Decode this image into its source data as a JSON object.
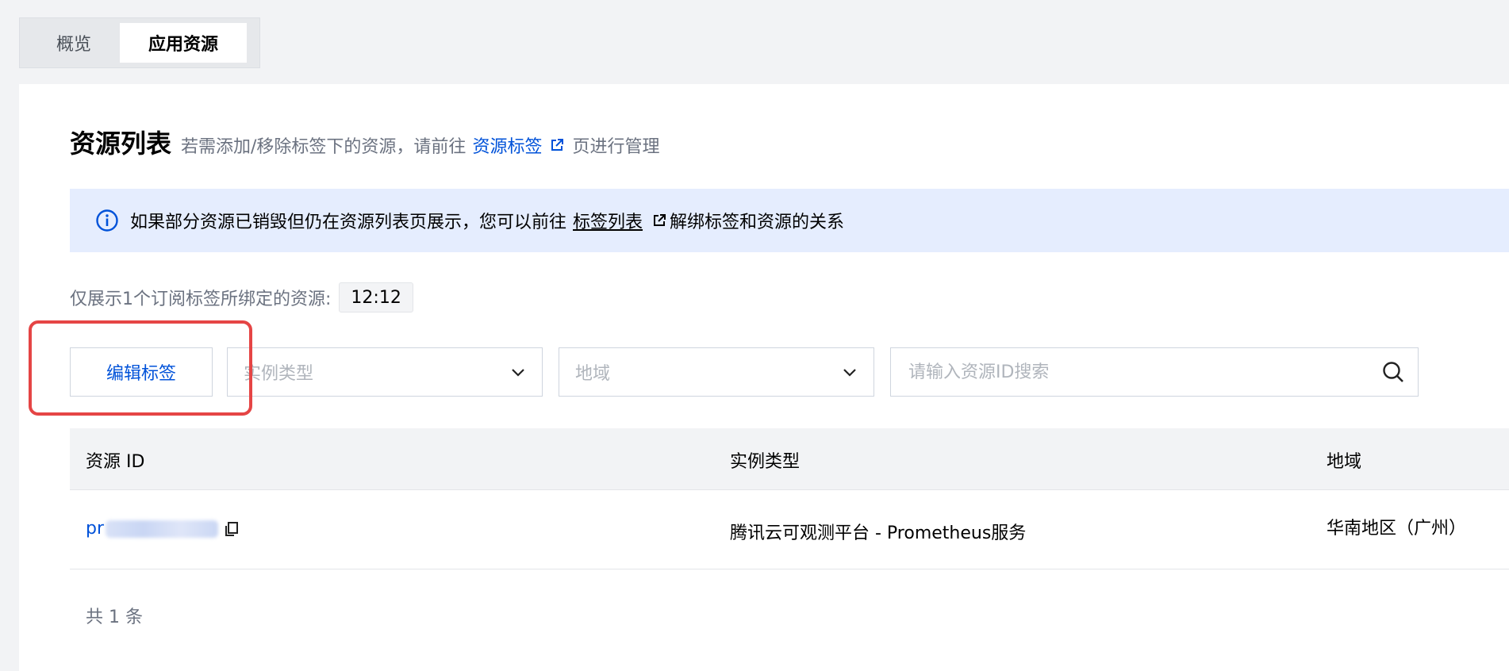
{
  "tabs": [
    {
      "label": "概览",
      "active": false
    },
    {
      "label": "应用资源",
      "active": true
    }
  ],
  "header": {
    "title": "资源列表",
    "desc_prefix": "若需添加/移除标签下的资源，请前往",
    "link": "资源标签",
    "desc_suffix": "页进行管理"
  },
  "alert": {
    "text_prefix": "如果部分资源已销毁但仍在资源列表页展示，您可以前往",
    "link": "标签列表",
    "text_suffix": "解绑标签和资源的关系"
  },
  "subscription": {
    "label": "仅展示1个订阅标签所绑定的资源:",
    "tag": "12:12"
  },
  "toolbar": {
    "edit_label": "编辑标签",
    "instance_type_placeholder": "实例类型",
    "region_placeholder": "地域",
    "search_placeholder": "请输入资源ID搜索"
  },
  "table": {
    "columns": [
      "资源 ID",
      "实例类型",
      "地域"
    ],
    "rows": [
      {
        "id_visible": "pr",
        "instance_type": "腾讯云可观测平台 - Prometheus服务",
        "region": "华南地区（广州）"
      }
    ]
  },
  "footer": {
    "total": "共 1 条"
  },
  "colors": {
    "accent": "#0052d9",
    "alert_bg": "#e5edfe",
    "highlight": "#e54545"
  },
  "icons": [
    "external-link-icon",
    "info-icon",
    "chevron-down-icon",
    "search-icon",
    "copy-icon"
  ]
}
